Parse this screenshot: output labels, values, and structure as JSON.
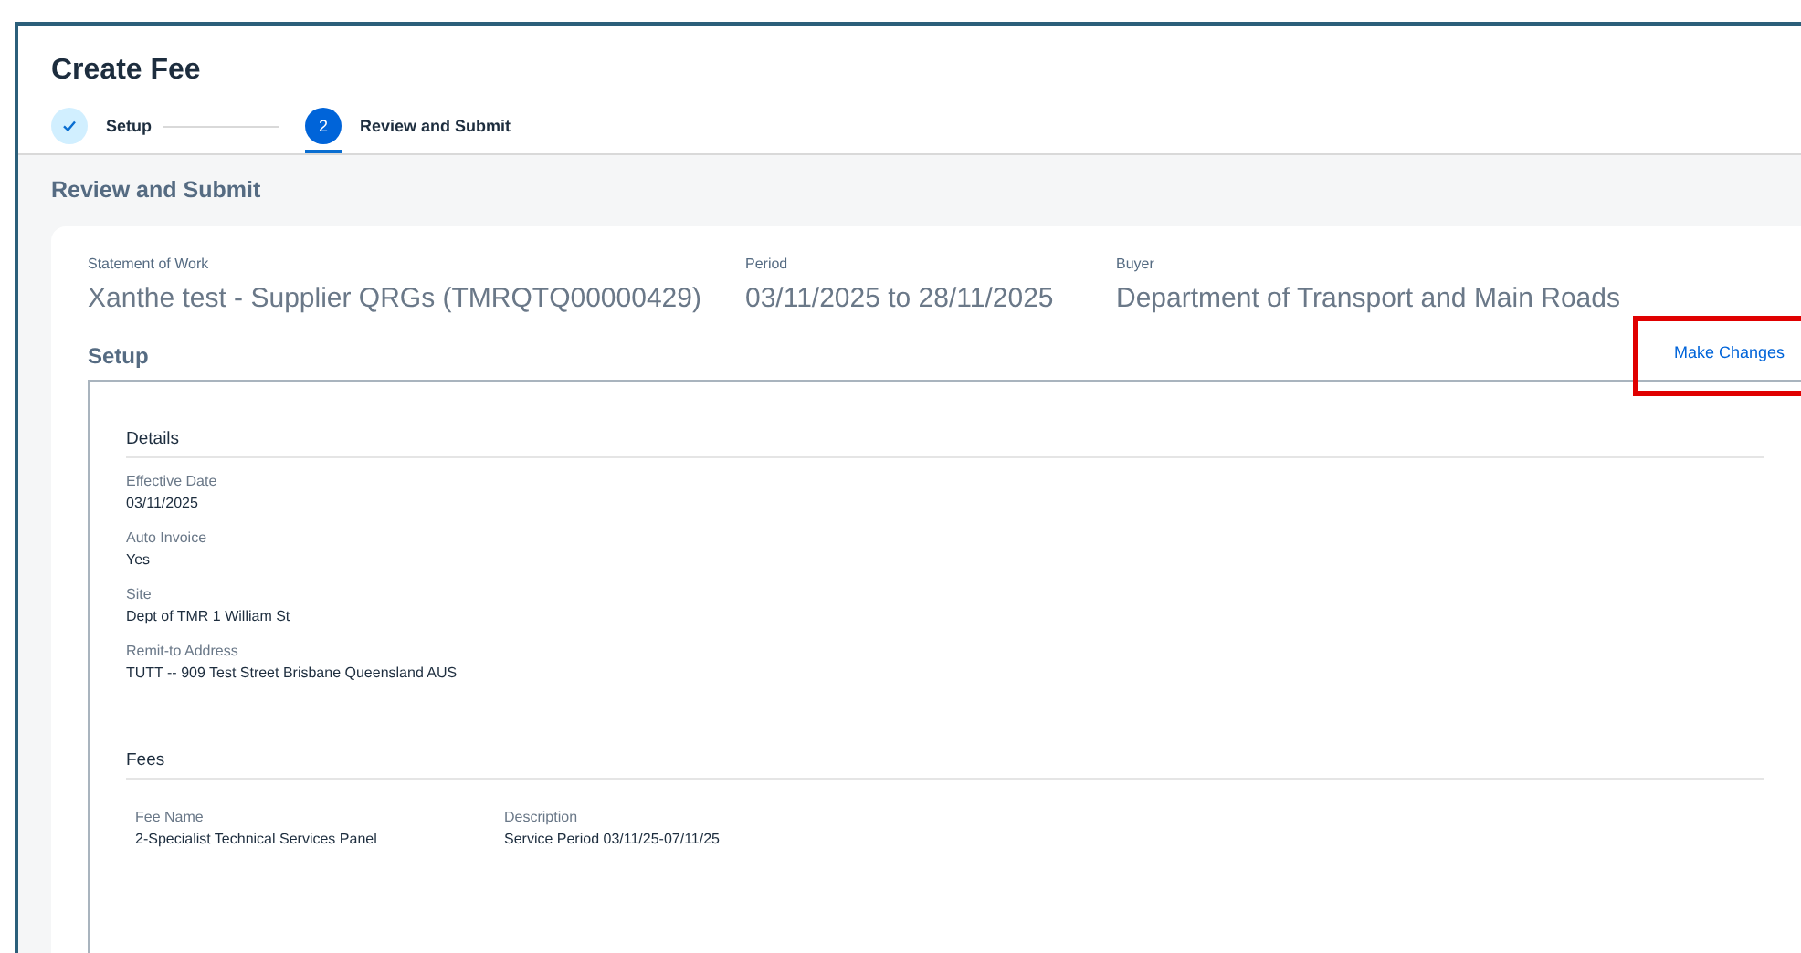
{
  "page": {
    "title": "Create Fee"
  },
  "steps": [
    {
      "label": "Setup",
      "completed": true,
      "selected": false
    },
    {
      "label": "Review and Submit",
      "number": "2",
      "completed": false,
      "selected": true
    }
  ],
  "section_title": "Review and Submit",
  "summary": [
    {
      "label": "Statement of Work",
      "value": "Xanthe test - Supplier QRGs (TMRQTQ00000429)"
    },
    {
      "label": "Period",
      "value": "03/11/2025 to 28/11/2025"
    },
    {
      "label": "Buyer",
      "value": "Department of Transport and Main Roads"
    }
  ],
  "setup": {
    "title": "Setup",
    "action": "Make Changes",
    "details": {
      "title": "Details",
      "fields": [
        {
          "label": "Effective Date",
          "value": "03/11/2025"
        },
        {
          "label": "Auto Invoice",
          "value": "Yes"
        },
        {
          "label": "Site",
          "value": "Dept of TMR 1 William St"
        },
        {
          "label": "Remit-to Address",
          "value": "TUTT -- 909 Test Street Brisbane Queensland AUS"
        }
      ]
    },
    "fees": {
      "title": "Fees",
      "columns": [
        "Fee Name",
        "Description"
      ],
      "rows": [
        [
          "2-Specialist Technical Services Panel",
          "Service Period 03/11/25-07/11/25"
        ]
      ]
    }
  }
}
